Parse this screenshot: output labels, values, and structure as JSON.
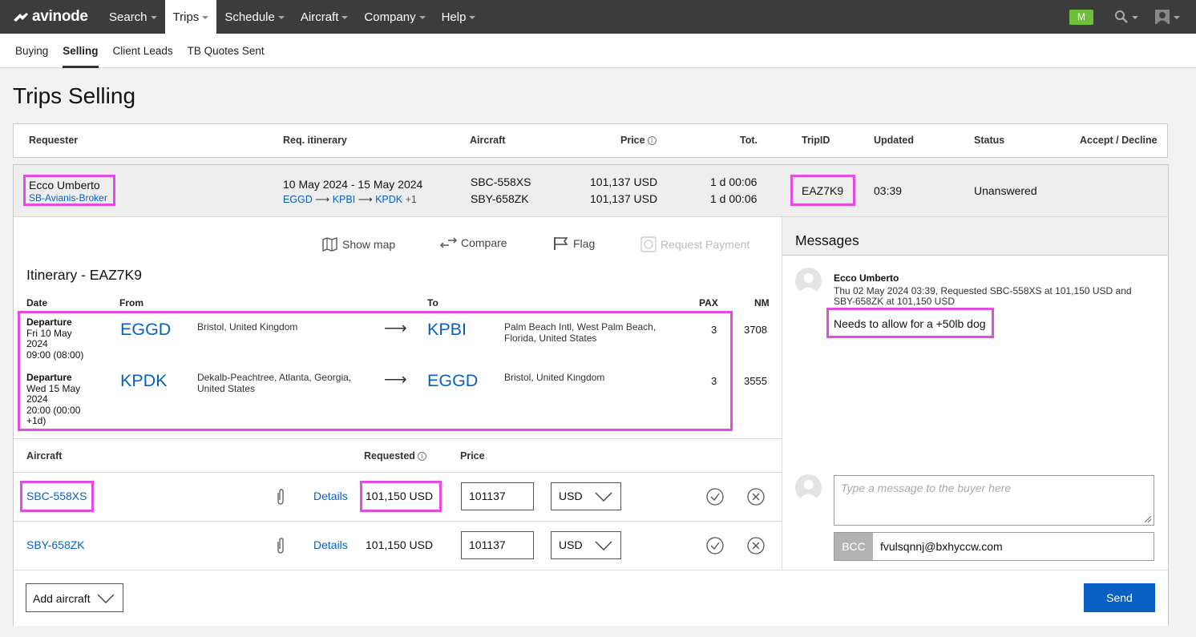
{
  "nav": {
    "logo": "avinode",
    "items": [
      {
        "label": "Search"
      },
      {
        "label": "Trips"
      },
      {
        "label": "Schedule"
      },
      {
        "label": "Aircraft"
      },
      {
        "label": "Company"
      },
      {
        "label": "Help"
      }
    ],
    "user_badge": "M"
  },
  "subnav": {
    "tabs": [
      "Buying",
      "Selling",
      "Client Leads",
      "TB Quotes Sent"
    ]
  },
  "page": {
    "title": "Trips Selling"
  },
  "table_header": {
    "requester": "Requester",
    "itinerary": "Req. itinerary",
    "aircraft": "Aircraft",
    "price": "Price",
    "total": "Tot.",
    "trip_id": "TripID",
    "updated": "Updated",
    "status": "Status",
    "accept_decline": "Accept / Decline"
  },
  "trip": {
    "requester_name": "Ecco Umberto",
    "requester_company": "SB-Avianis-Broker",
    "dates": "10 May 2024 - 15 May 2024",
    "route": [
      "EGGD",
      "KPBI",
      "KPDK"
    ],
    "route_extra": "+1",
    "aircraft": [
      "SBC-558XS",
      "SBY-658ZK"
    ],
    "prices": [
      "101,137 USD",
      "101,137 USD"
    ],
    "totals": [
      "1 d 00:06",
      "1 d 00:06"
    ],
    "trip_id": "EAZ7K9",
    "updated": "03:39",
    "status": "Unanswered"
  },
  "actions": {
    "show_map": "Show map",
    "compare": "Compare",
    "flag": "Flag",
    "request_payment": "Request Payment"
  },
  "itinerary": {
    "title": "Itinerary - EAZ7K9",
    "headers": {
      "date": "Date",
      "from": "From",
      "to": "To",
      "pax": "PAX",
      "nm": "NM"
    },
    "legs": [
      {
        "type": "Departure",
        "date_lines": [
          "Fri 10 May",
          "2024",
          "09:00 (08:00)"
        ],
        "from_code": "EGGD",
        "from_place": "Bristol, United Kingdom",
        "to_code": "KPBI",
        "to_place": "Palm Beach Intl, West Palm Beach, Florida, United States",
        "pax": "3",
        "nm": "3708"
      },
      {
        "type": "Departure",
        "date_lines": [
          "Wed 15 May",
          "2024",
          "20:00 (00:00",
          "+1d)"
        ],
        "from_code": "KPDK",
        "from_place": "Dekalb-Peachtree, Atlanta, Georgia, United States",
        "to_code": "EGGD",
        "to_place": "Bristol, United Kingdom",
        "pax": "3",
        "nm": "3555"
      }
    ]
  },
  "aircraft_table": {
    "headers": {
      "aircraft": "Aircraft",
      "requested": "Requested",
      "price": "Price"
    },
    "rows": [
      {
        "reg": "SBC-558XS",
        "details": "Details",
        "requested": "101,150 USD",
        "price": "101137",
        "currency": "USD"
      },
      {
        "reg": "SBY-658ZK",
        "details": "Details",
        "requested": "101,150 USD",
        "price": "101137",
        "currency": "USD"
      }
    ],
    "add_aircraft": "Add aircraft"
  },
  "messages": {
    "title": "Messages",
    "items": [
      {
        "from": "Ecco Umberto",
        "meta": "Thu 02 May 2024 03:39, Requested SBC-558XS at 101,150 USD and SBY-658ZK at 101,150 USD",
        "text": "Needs to allow for a +50lb dog"
      }
    ],
    "input_placeholder": "Type a message to the buyer here",
    "bcc_label": "BCC",
    "bcc_value": "fvulsqnnj@bxhyccw.com",
    "send_label": "Send"
  },
  "colors": {
    "nav_bg": "#3c3c3c",
    "link": "#0a5fc2",
    "highlight": "#e74ae3",
    "send_button": "#0a5fc2",
    "badge": "#6fbf3c"
  }
}
